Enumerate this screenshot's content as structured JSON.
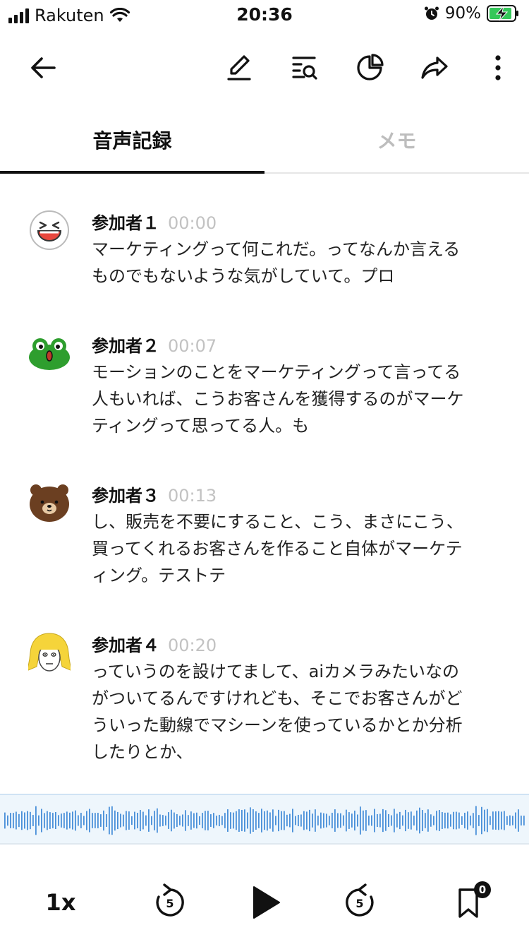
{
  "status_bar": {
    "carrier": "Rakuten",
    "time": "20:36",
    "battery": "90%",
    "icons": [
      "signal-icon",
      "wifi-icon",
      "alarm-icon",
      "battery-charging-icon"
    ]
  },
  "nav": {
    "icons": [
      "back-arrow-icon",
      "edit-pencil-icon",
      "search-transcript-icon",
      "pie-chart-icon",
      "share-icon",
      "more-vertical-icon"
    ]
  },
  "tabs": [
    {
      "label": "音声記録",
      "active": true
    },
    {
      "label": "メモ",
      "active": false
    }
  ],
  "entries": [
    {
      "speaker": "参加者１",
      "time": "00:00",
      "avatar": "laughing-face-avatar",
      "lines": [
        "マーケティングって何これだ。ってなんか言える",
        "ものでもないような気がしていて。プロ"
      ]
    },
    {
      "speaker": "参加者２",
      "time": "00:07",
      "avatar": "frog-avatar",
      "lines": [
        "モーションのことをマーケティングって言ってる",
        "人もいれば、こうお客さんを獲得するのがマーケ",
        "ティングって思ってる人。も"
      ]
    },
    {
      "speaker": "参加者３",
      "time": "00:13",
      "avatar": "bear-avatar",
      "lines": [
        "し、販売を不要にすること、こう、まさにこう、",
        "買ってくれるお客さんを作ること自体がマーケテ",
        "ィング。テストテ"
      ]
    },
    {
      "speaker": "参加者４",
      "time": "00:20",
      "avatar": "blonde-girl-avatar",
      "lines": [
        "っていうのを設けてまして、aiカメラみたいなの",
        "がついてるんですけれども、そこでお客さんがど",
        "ういった動線でマシーンを使っているかとか分析",
        "したりとか、"
      ]
    }
  ],
  "controls": {
    "speed_label": "1x",
    "rewind_seconds": "5",
    "forward_seconds": "5",
    "bookmark_count": "0",
    "icons": [
      "rewind-5-icon",
      "play-icon",
      "forward-5-icon",
      "bookmark-icon"
    ]
  },
  "colors": {
    "accent": "#111111",
    "waveform": "#4a90d9",
    "waveform_bg": "#eef6fc",
    "timecode": "#c2c2c2"
  }
}
